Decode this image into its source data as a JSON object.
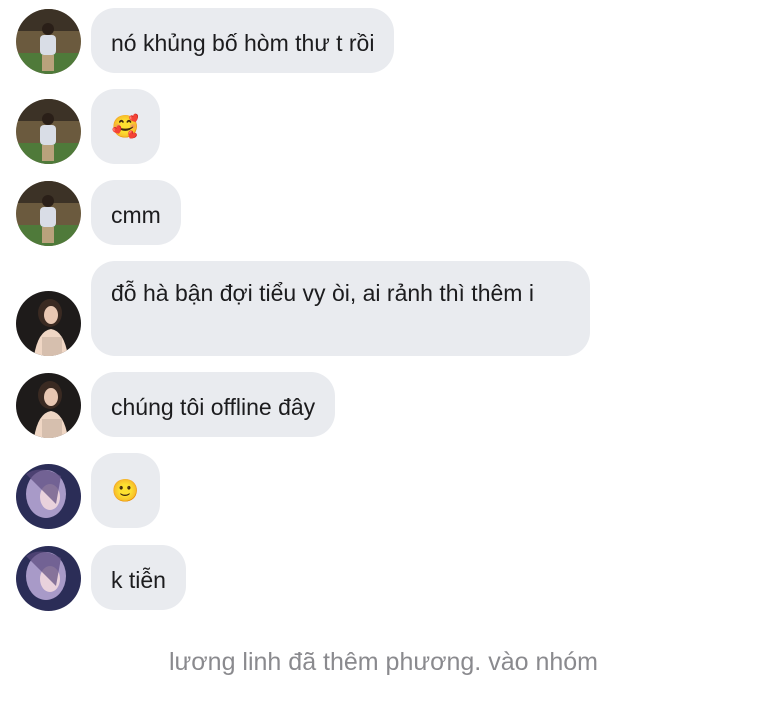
{
  "messages": [
    {
      "sender": "user-a",
      "text": "nó khủng bố hòm thư t rồi"
    },
    {
      "sender": "user-a",
      "text": "🥰"
    },
    {
      "sender": "user-a",
      "text": "cmm"
    },
    {
      "sender": "user-b",
      "text": "đỗ hà bận đợi tiểu vy òi, ai rảnh thì thêm i"
    },
    {
      "sender": "user-b",
      "text": "chúng tôi offline đây"
    },
    {
      "sender": "user-c",
      "text": "🙂"
    },
    {
      "sender": "user-c",
      "text": "k tiễn"
    }
  ],
  "system_note": "lương linh đã thêm phương. vào nhóm",
  "colors": {
    "bubble": "#e9ebef",
    "text": "#1c1c1e",
    "system_text": "#8a8a8e",
    "background": "#ffffff"
  }
}
